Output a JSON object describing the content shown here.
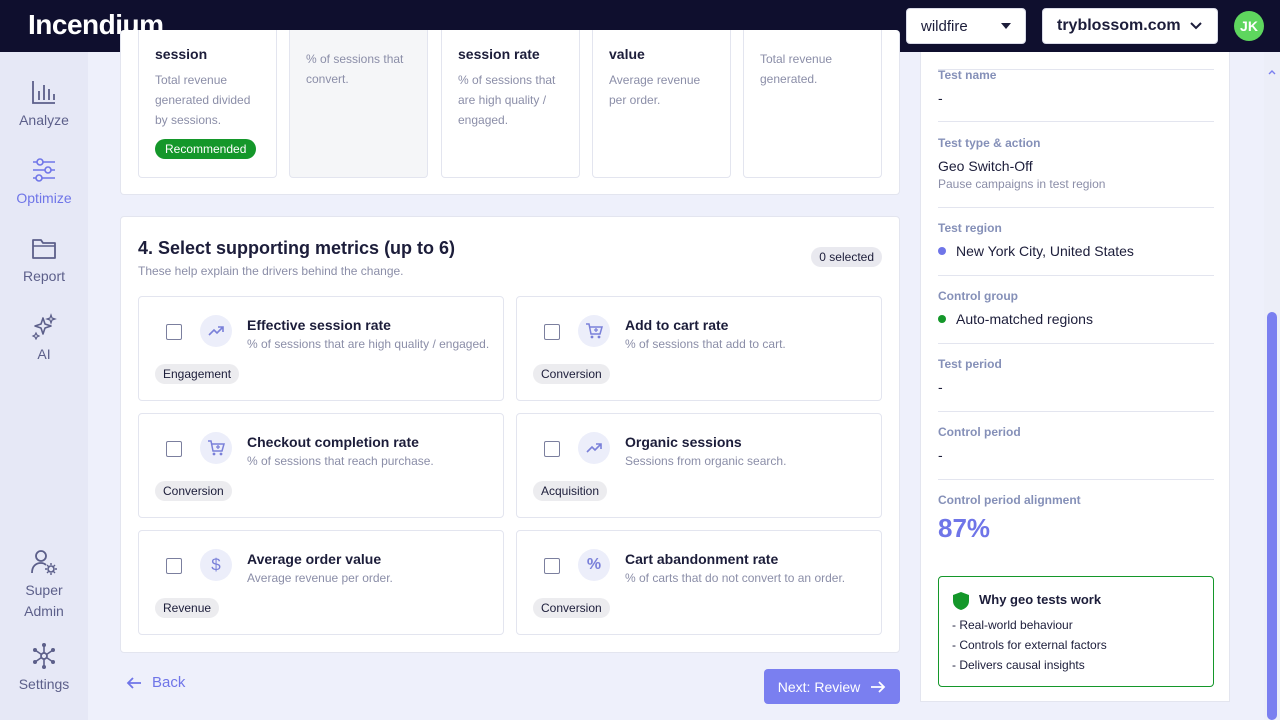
{
  "header": {
    "logo": "Incendium",
    "workspace_select": "wildfire",
    "site_select": "tryblossom.com",
    "avatar_initials": "JK",
    "colors": {
      "topbar": "#0f0f2e",
      "accent": "#6f75e8",
      "avatar": "#5ed65e"
    }
  },
  "sidebar": {
    "items": [
      {
        "label": "Analyze",
        "icon": "bar-chart-icon"
      },
      {
        "label": "Optimize",
        "icon": "sliders-icon"
      },
      {
        "label": "Report",
        "icon": "folder-icon"
      },
      {
        "label": "AI",
        "icon": "sparkles-icon"
      }
    ],
    "bottom_items": [
      {
        "label_line1": "Super",
        "label_line2": "Admin",
        "icon": "user-gear-icon"
      },
      {
        "label": "Settings",
        "icon": "network-icon"
      }
    ]
  },
  "primary_cards": [
    {
      "title": "session",
      "desc": "Total revenue generated divided by sessions.",
      "badge": "Recommended"
    },
    {
      "title": "",
      "desc": "% of sessions that convert.",
      "badge": ""
    },
    {
      "title": "session rate",
      "desc": "% of sessions that are high quality / engaged.",
      "badge": ""
    },
    {
      "title": "value",
      "desc": "Average revenue per order.",
      "badge": ""
    },
    {
      "title": "",
      "desc": "Total revenue generated.",
      "badge": ""
    }
  ],
  "supporting": {
    "title": "4. Select supporting metrics (up to 6)",
    "subtitle": "These help explain the drivers behind the change.",
    "selected_count": "0 selected",
    "metrics": [
      {
        "title": "Effective session rate",
        "desc": "% of sessions that are high quality / engaged.",
        "tag": "Engagement",
        "icon": "trend-up-icon"
      },
      {
        "title": "Add to cart rate",
        "desc": "% of sessions that add to cart.",
        "tag": "Conversion",
        "icon": "cart-plus-icon"
      },
      {
        "title": "Checkout completion rate",
        "desc": "% of sessions that reach purchase.",
        "tag": "Conversion",
        "icon": "cart-plus-icon"
      },
      {
        "title": "Organic sessions",
        "desc": "Sessions from organic search.",
        "tag": "Acquisition",
        "icon": "trend-up-icon"
      },
      {
        "title": "Average order value",
        "desc": "Average revenue per order.",
        "tag": "Revenue",
        "icon": "dollar-icon"
      },
      {
        "title": "Cart abandonment rate",
        "desc": "% of carts that do not convert to an order.",
        "tag": "Conversion",
        "icon": "percent-icon"
      }
    ]
  },
  "actions": {
    "back": "Back",
    "next": "Next: Review"
  },
  "summary": {
    "test_name_label": "Test name",
    "test_name_value": "-",
    "test_type_label": "Test type & action",
    "test_type_value": "Geo Switch-Off",
    "test_type_sub": "Pause campaigns in test region",
    "test_region_label": "Test region",
    "test_region_value": "New York City, United States",
    "control_group_label": "Control group",
    "control_group_value": "Auto-matched regions",
    "test_period_label": "Test period",
    "test_period_value": "-",
    "control_period_label": "Control period",
    "control_period_value": "-",
    "alignment_label": "Control period alignment",
    "alignment_value": "87%",
    "why_title": "Why geo tests work",
    "why_items": [
      "- Real-world behaviour",
      "- Controls for external factors",
      "- Delivers causal insights"
    ]
  }
}
